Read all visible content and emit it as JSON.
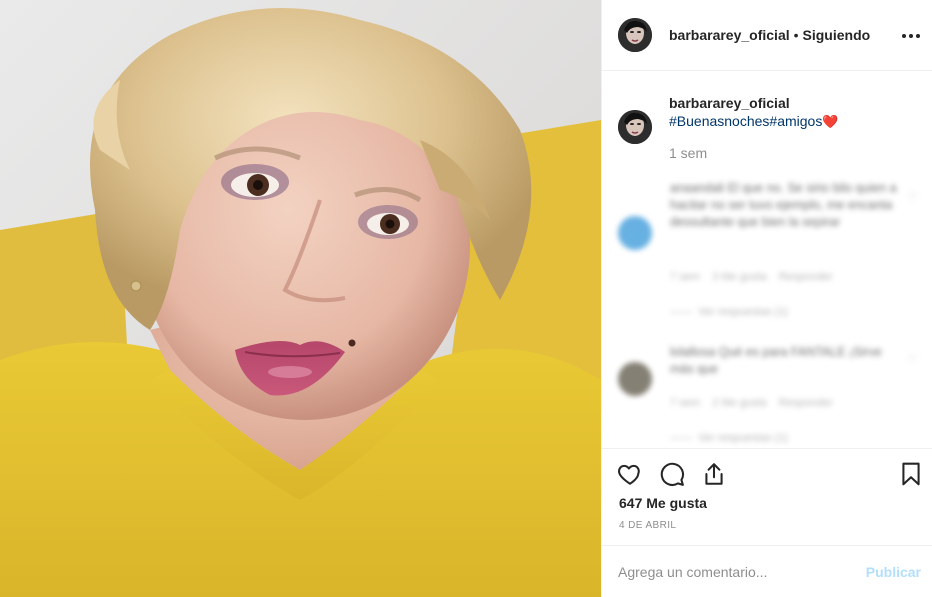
{
  "post": {
    "username": "barbararey_oficial",
    "follow_status": "Siguiendo",
    "separator": "•"
  },
  "caption": {
    "username": "barbararey_oficial",
    "text": "#Buenasnoches#amigos",
    "emoji": "❤️",
    "time": "1 sem"
  },
  "blurred_comments": [
    {
      "text": "anaandali El que no. Se sirio bilo quien a hacitar no ser tuvo ejemplo, me encanta dessultante que bien la sepirar",
      "time": "7 sem",
      "likes": "3 Me gusta",
      "reply": "Responder",
      "view_replies": "Ver respuestas (1)"
    },
    {
      "text": "lolallosa Qué es para FANTALE ¡Sirve más que",
      "time": "7 sem",
      "likes": "2 Me gusta",
      "reply": "Responder",
      "view_replies": "Ver respuestas (1)"
    }
  ],
  "actions": {
    "likes": "647 Me gusta",
    "date": "4 DE ABRIL"
  },
  "comment_form": {
    "placeholder": "Agrega un comentario...",
    "publish_label": "Publicar"
  },
  "colors": {
    "link": "#003569",
    "muted": "#8e8e8e",
    "publish_disabled": "#b2dffc",
    "sweater": "#e7c63a"
  },
  "icons": [
    "heart-icon",
    "comment-icon",
    "share-icon",
    "bookmark-icon",
    "more-options-icon"
  ]
}
